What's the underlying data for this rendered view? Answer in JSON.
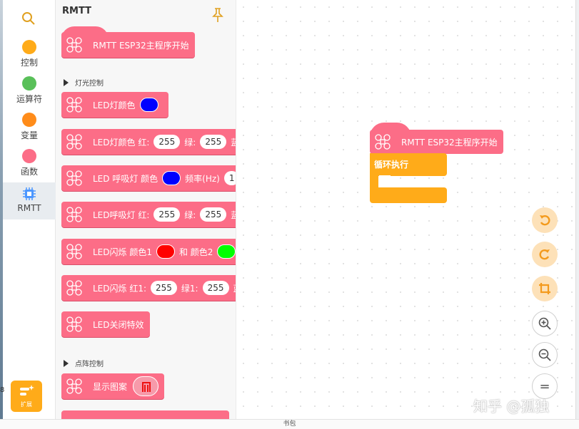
{
  "sidebar": {
    "search_icon": "search-icon",
    "categories": [
      {
        "label": "控制",
        "color": "#ffab19"
      },
      {
        "label": "运算符",
        "color": "#59c059"
      },
      {
        "label": "变量",
        "color": "#ff8c1a"
      },
      {
        "label": "函数",
        "color": "#fc6d87"
      },
      {
        "label": "RMTT",
        "color": "#4c97ff",
        "icon": "chip-icon"
      }
    ],
    "extension_label": "扩展",
    "edge_mark": "8"
  },
  "flyout": {
    "title": "RMTT",
    "pin_icon": "pin-icon",
    "main_start": "RMTT ESP32主程序开始",
    "sections": [
      "灯光控制",
      "点阵控制"
    ],
    "blocks": {
      "led_color": {
        "label": "LED灯颜色",
        "color": "#0000ff"
      },
      "led_rgb": {
        "label": "LED灯颜色 红:",
        "r": "255",
        "g_label": "绿:",
        "g": "255",
        "b_label": "蓝:"
      },
      "breath": {
        "label": "LED 呼吸灯 颜色",
        "color": "#0000ff",
        "freq_label": "频率(Hz)",
        "freq": "1"
      },
      "breath_rgb": {
        "label": "LED呼吸灯 红:",
        "r": "255",
        "g_label": "绿:",
        "g": "255",
        "b_label": "蓝:"
      },
      "blink": {
        "label": "LED闪烁 颜色1",
        "c1": "#ff0000",
        "and_label": "和 颜色2",
        "c2": "#00ff00"
      },
      "blink_rgb": {
        "label": "LED闪烁 红1:",
        "r": "255",
        "g_label": "绿1:",
        "g": "255",
        "b_label": "蓝"
      },
      "off": {
        "label": "LED关闭特效"
      },
      "show_pattern": {
        "label": "显示图案"
      }
    }
  },
  "workspace": {
    "hat_label": "RMTT ESP32主程序开始",
    "loop_label": "循环执行",
    "controls": [
      "undo-icon",
      "redo-icon",
      "crop-icon",
      "zoom-in-icon",
      "zoom-out-icon",
      "reset-zoom-icon"
    ],
    "reset_glyph": "="
  },
  "watermark": "知乎 @孤独",
  "bottom_bar": {
    "label": "书包"
  }
}
